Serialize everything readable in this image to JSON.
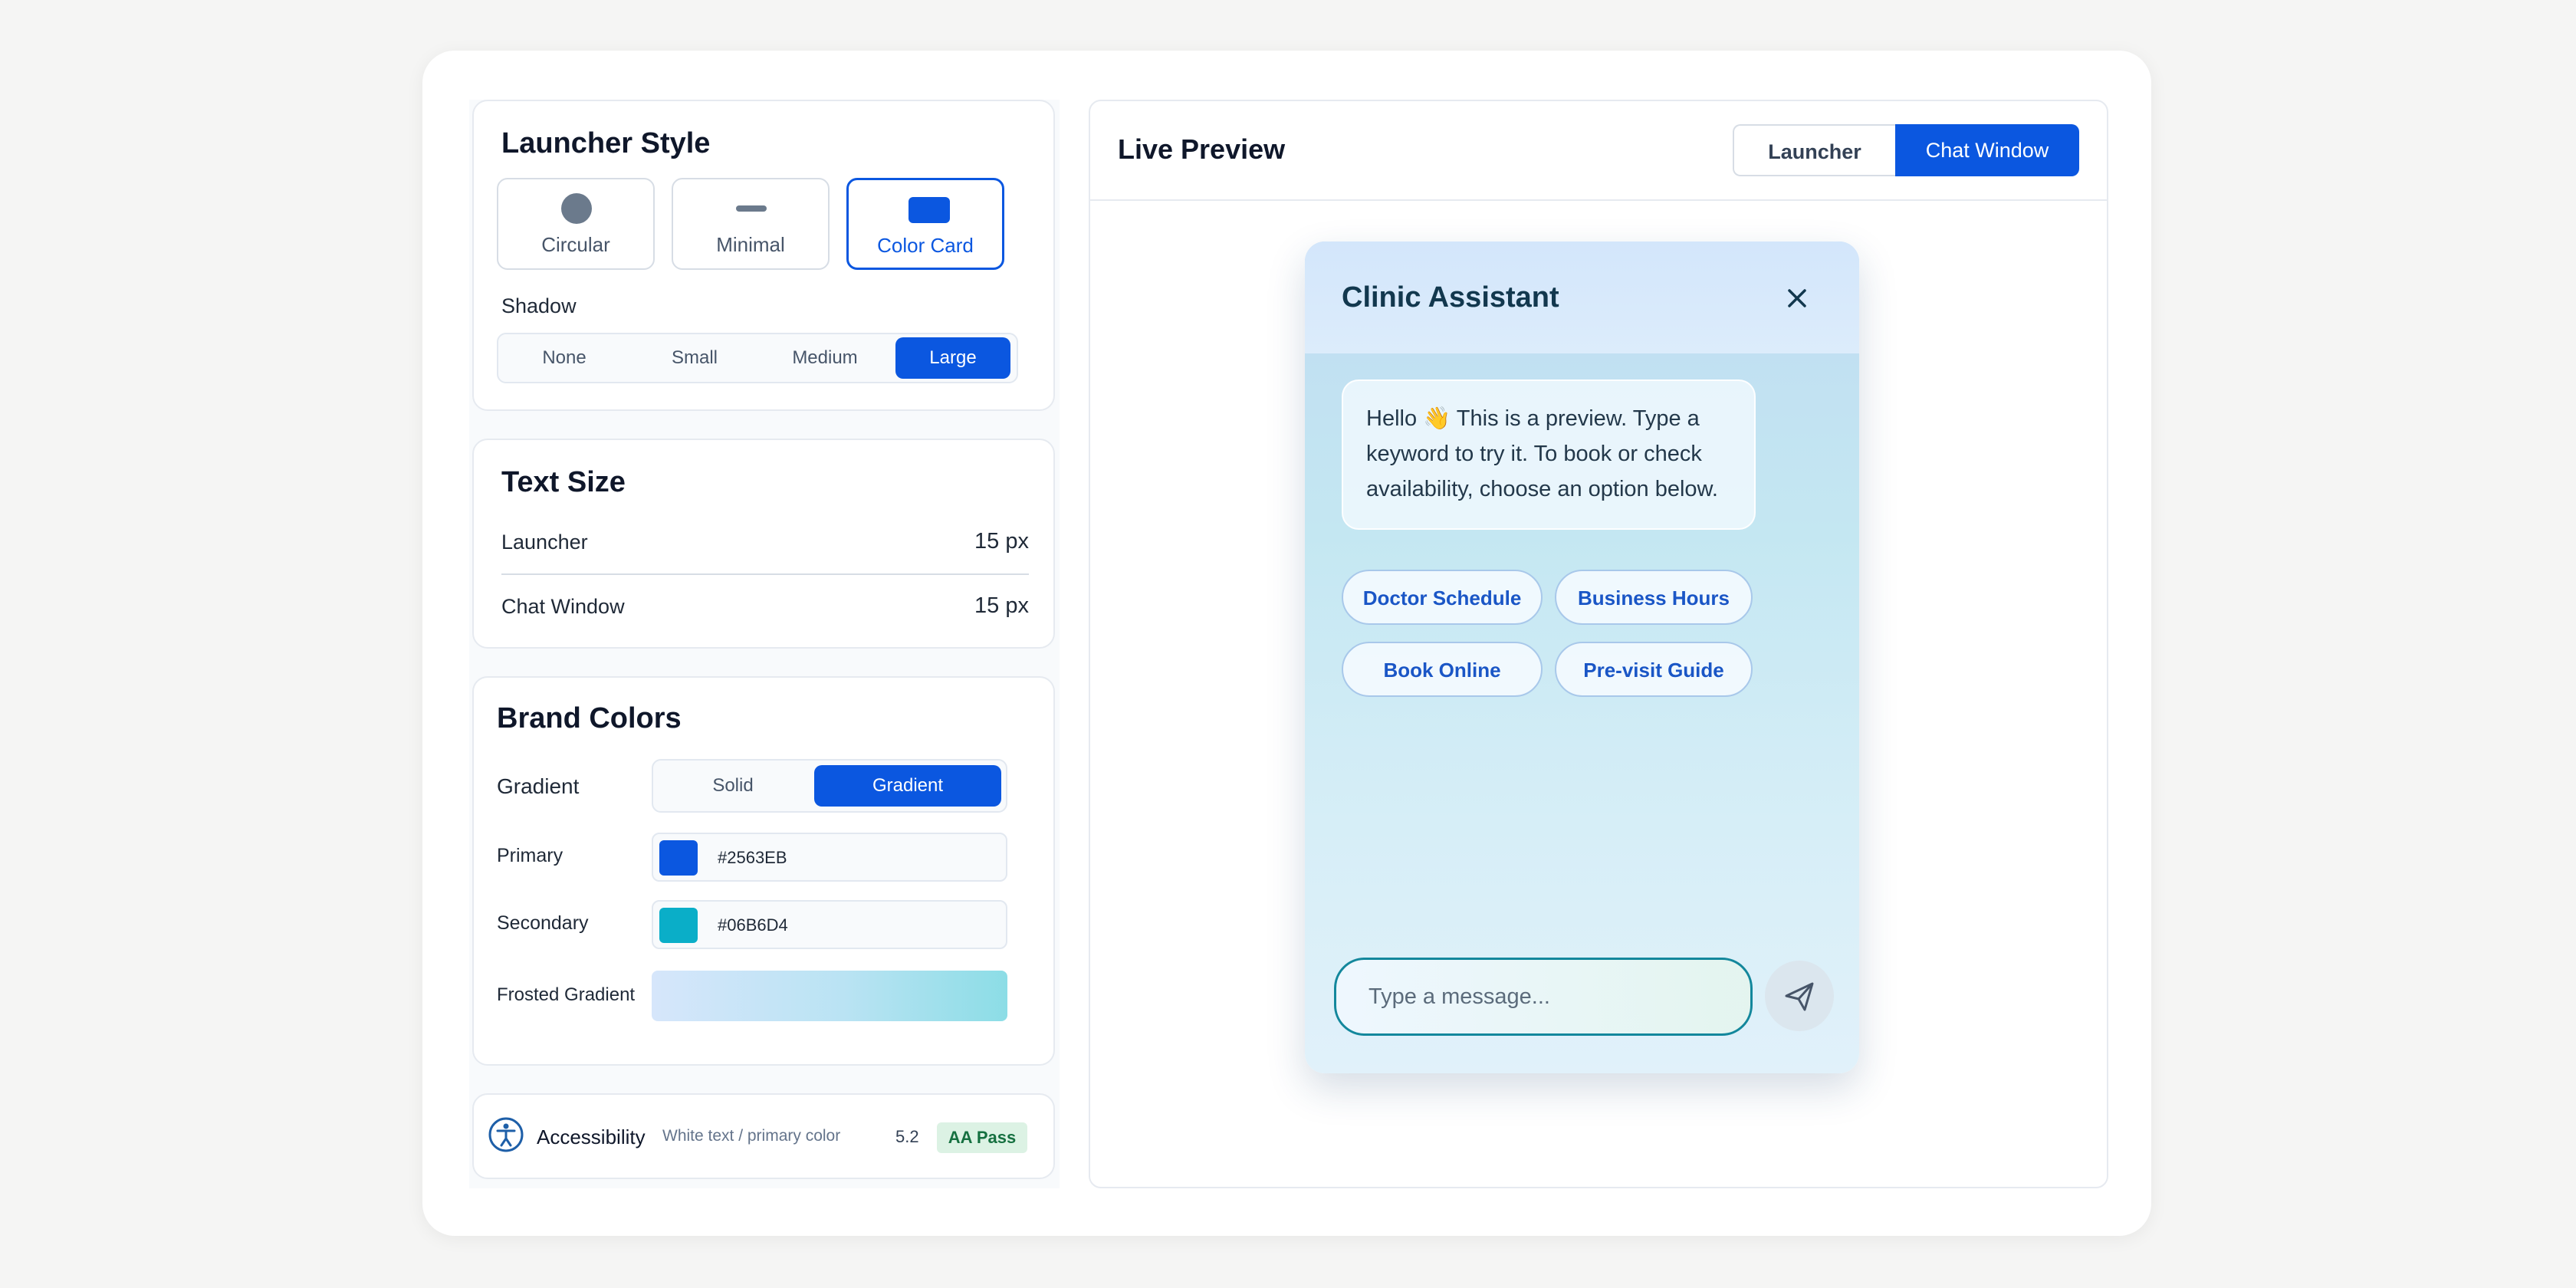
{
  "launcher_style": {
    "title": "Launcher Style",
    "options": [
      {
        "label": "Circular",
        "icon": "circle-shape-icon"
      },
      {
        "label": "Minimal",
        "icon": "dash-shape-icon"
      },
      {
        "label": "Color Card",
        "icon": "rectangle-shape-icon",
        "selected": true
      }
    ],
    "shadow_label": "Shadow",
    "shadow_options": [
      "None",
      "Small",
      "Medium",
      "Large"
    ],
    "shadow_selected": "Large"
  },
  "text_size": {
    "title": "Text Size",
    "rows": [
      {
        "label": "Launcher",
        "value": "15 px"
      },
      {
        "label": "Chat Window",
        "value": "15 px"
      }
    ]
  },
  "brand_colors": {
    "title": "Brand Colors",
    "mode_label": "Gradient",
    "mode_options": [
      "Solid",
      "Gradient"
    ],
    "mode_selected": "Gradient",
    "primary_label": "Primary",
    "primary_value": "#2563EB",
    "secondary_label": "Secondary",
    "secondary_value": "#06B6D4",
    "gradient_label": "Frosted Gradient"
  },
  "accessibility": {
    "label": "Accessibility",
    "description": "White text / primary color",
    "ratio": "5.2",
    "badge": "AA Pass"
  },
  "preview": {
    "title": "Live Preview",
    "tabs": [
      "Launcher",
      "Chat Window"
    ],
    "active_tab": "Chat Window"
  },
  "chat": {
    "title": "Clinic Assistant",
    "greeting": "Hello 👋 This is a preview. Type a keyword to try it. To book or check availability, choose an option below.",
    "quick_replies": [
      "Doctor Schedule",
      "Business Hours",
      "Book Online",
      "Pre-visit Guide"
    ],
    "input_placeholder": "Type a message..."
  },
  "colors": {
    "accent": "#0B57E0",
    "primary_swatch": "#0B57E0",
    "secondary_swatch": "#06B6D4",
    "badge_bg": "#DCF2E4"
  }
}
